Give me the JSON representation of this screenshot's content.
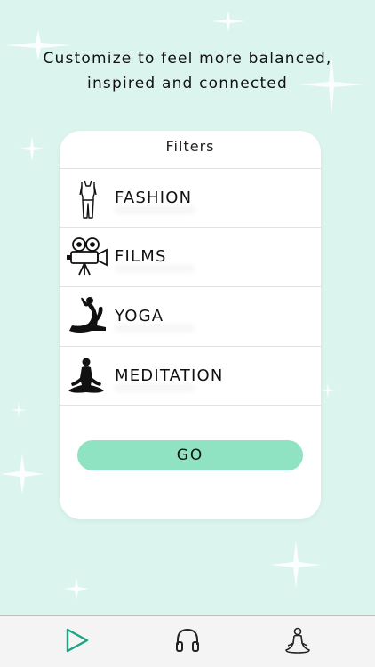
{
  "app": {
    "tagline_line1": "Customize to feel more balanced,",
    "tagline_line2": "inspired and connected"
  },
  "filters": {
    "title": "Filters",
    "items": [
      {
        "label": "FASHION",
        "icon": "fashion-figure-icon"
      },
      {
        "label": "FILMS",
        "icon": "film-camera-icon"
      },
      {
        "label": "YOGA",
        "icon": "yoga-pose-icon"
      },
      {
        "label": "MEDITATION",
        "icon": "meditation-icon"
      }
    ],
    "go_label": "GO"
  },
  "tabbar": {
    "tabs": [
      {
        "icon": "play-icon"
      },
      {
        "icon": "headphones-icon"
      },
      {
        "icon": "meditation-person-icon"
      }
    ]
  },
  "colors": {
    "background": "#dcf4ee",
    "accent": "#8fe3c2",
    "play_icon": "#1aa583"
  }
}
